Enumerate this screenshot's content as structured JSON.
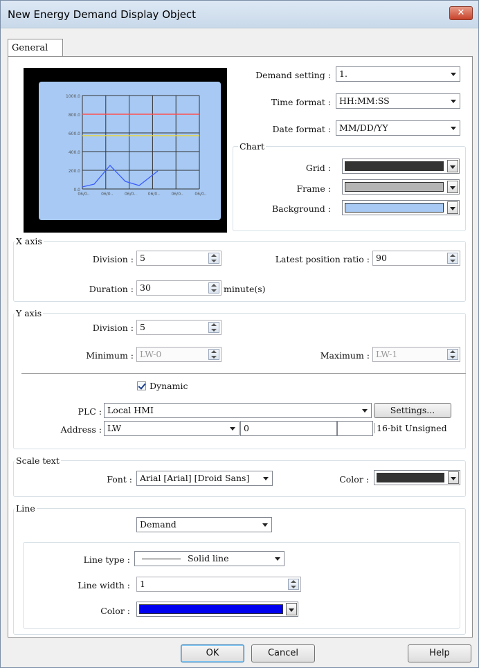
{
  "window": {
    "title": "New Energy Demand Display Object",
    "close": "✕"
  },
  "tabs": [
    {
      "label": "General"
    }
  ],
  "preview": {
    "y_ticks": [
      "1000.0",
      "800.0",
      "600.0",
      "400.0",
      "200.0",
      "0.0"
    ],
    "x_ticks": [
      "06/0..",
      "06/0..",
      "06/0..",
      "06/0..",
      "06/0..",
      "06/0.."
    ],
    "grid_color": "#333333",
    "line_color": "#3b5cff",
    "limit_high_color": "#ff5050",
    "limit_low_color": "#e8d640"
  },
  "demand": {
    "demand_setting_label": "Demand setting :",
    "demand_setting_value": "1.",
    "time_format_label": "Time format :",
    "time_format_value": "HH:MM:SS",
    "date_format_label": "Date format :",
    "date_format_value": "MM/DD/YY"
  },
  "chart": {
    "group_label": "Chart",
    "grid_label": "Grid :",
    "grid_color": "#333333",
    "frame_label": "Frame :",
    "frame_color": "#b4b4b4",
    "background_label": "Background :",
    "background_color": "#a7c9f3"
  },
  "x_axis": {
    "group_label": "X axis",
    "division_label": "Division :",
    "division_value": "5",
    "latest_label": "Latest position ratio :",
    "latest_value": "90",
    "duration_label": "Duration :",
    "duration_value": "30",
    "duration_unit": "minute(s)"
  },
  "y_axis": {
    "group_label": "Y axis",
    "division_label": "Division :",
    "division_value": "5",
    "minimum_label": "Minimum :",
    "minimum_value": "LW-0",
    "maximum_label": "Maximum :",
    "maximum_value": "LW-1",
    "dynamic_label": "Dynamic",
    "plc_label": "PLC :",
    "plc_value": "Local HMI",
    "settings_button": "Settings...",
    "address_label": "Address :",
    "address_type": "LW",
    "address_value": "0",
    "address_extra": "",
    "data_format": "16-bit Unsigned"
  },
  "scale_text": {
    "group_label": "Scale text",
    "font_label": "Font :",
    "font_value": "Arial [Arial] [Droid Sans]",
    "color_label": "Color :",
    "color_value": "#333333"
  },
  "line": {
    "group_label": "Line",
    "selection": "Demand",
    "line_type_label": "Line type :",
    "line_type_value": "Solid line",
    "line_width_label": "Line width :",
    "line_width_value": "1",
    "color_label": "Color :",
    "color_value": "#0000ee"
  },
  "buttons": {
    "ok": "OK",
    "cancel": "Cancel",
    "help": "Help"
  }
}
